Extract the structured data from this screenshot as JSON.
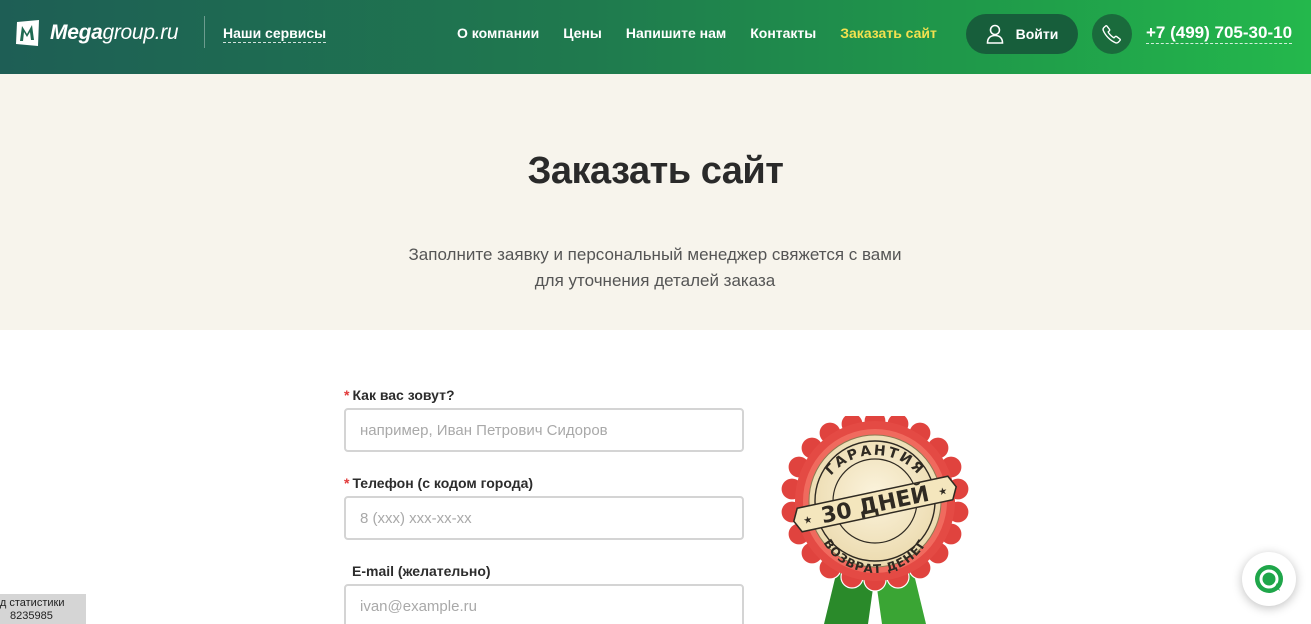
{
  "header": {
    "logo": {
      "bold": "Mega",
      "light": "group.ru"
    },
    "services_link": "Наши сервисы",
    "nav": [
      {
        "label": "О компании"
      },
      {
        "label": "Цены"
      },
      {
        "label": "Напишите нам"
      },
      {
        "label": "Контакты"
      },
      {
        "label": "Заказать сайт",
        "active": true
      }
    ],
    "login_label": "Войти",
    "phone": "+7 (499) 705-30-10",
    "active_color": "#f2e14f"
  },
  "hero": {
    "title": "Заказать сайт",
    "subtitle_line1": "Заполните заявку и персональный менеджер свяжется с вами",
    "subtitle_line2": "для уточнения деталей заказа"
  },
  "form": {
    "name": {
      "label": "Как вас зовут?",
      "required": true,
      "placeholder": "например, Иван Петрович Сидоров",
      "value": ""
    },
    "phone": {
      "label": "Телефон (с кодом города)",
      "required": true,
      "placeholder": "8 (xxx) xxx-xx-xx",
      "value": ""
    },
    "email": {
      "label": "E-mail (желательно)",
      "required": false,
      "placeholder": "ivan@example.ru",
      "value": ""
    }
  },
  "badge": {
    "top_text": "ГАРАНТИЯ",
    "main_text": "30 ДНЕЙ",
    "bottom_text": "ВОЗВРАТ ДЕНЕГ"
  },
  "stats": {
    "line1": "од статистики",
    "line2": "8235985"
  },
  "icons": {
    "logo": "megagroup-logo-icon",
    "user": "user-icon",
    "phone": "phone-icon",
    "chat": "chat-icon"
  }
}
